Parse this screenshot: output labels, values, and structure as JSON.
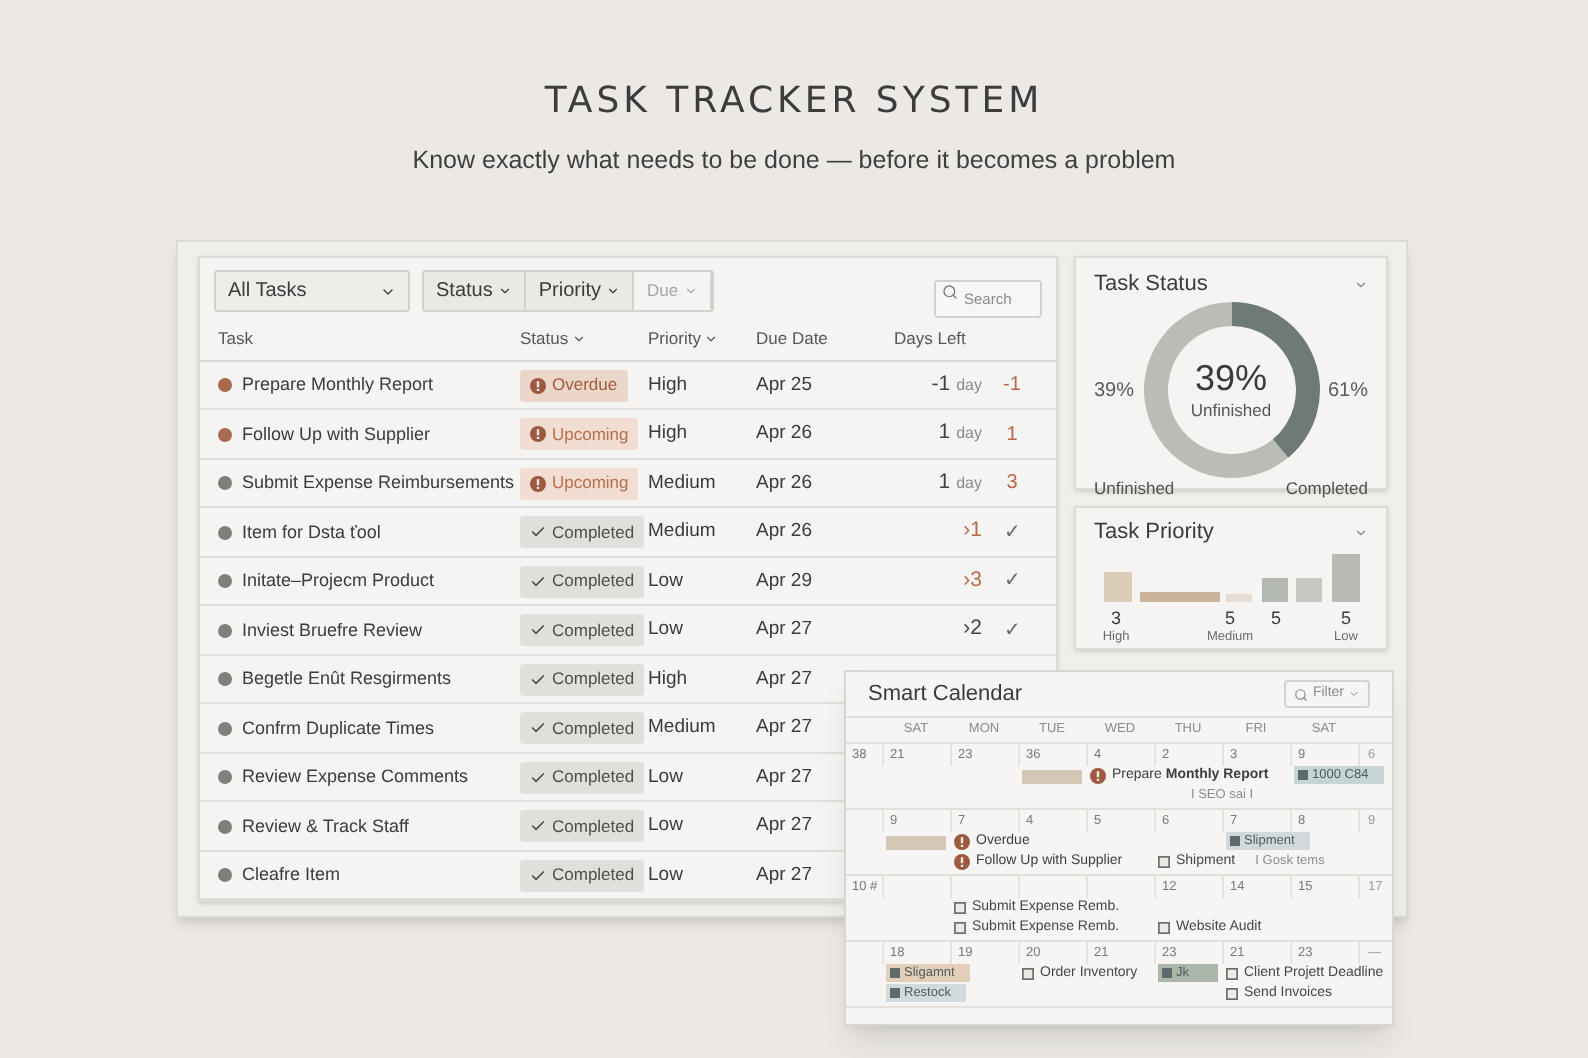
{
  "page": {
    "title": "TASK TRACKER SYSTEM",
    "subtitle": "Know exactly what needs to be done — before it becomes a problem"
  },
  "toolbar": {
    "view": {
      "label": "All Tasks"
    },
    "filters": [
      {
        "label": "Status",
        "disabled": false
      },
      {
        "label": "Priority",
        "disabled": false
      },
      {
        "label": "Due",
        "disabled": true
      }
    ],
    "search": {
      "placeholder": "Search"
    }
  },
  "table": {
    "columns": [
      {
        "label": "Task",
        "sortable": false
      },
      {
        "label": "Status",
        "sortable": true
      },
      {
        "label": "Priority",
        "sortable": true
      },
      {
        "label": "Due Date",
        "sortable": false
      },
      {
        "label": "Days Left",
        "sortable": false
      }
    ],
    "rows": [
      {
        "task": "Prepare Monthly Report",
        "color": "#a86a4f",
        "status": {
          "kind": "overdue",
          "label": "Overdue"
        },
        "priority": "High",
        "due": "Apr 25",
        "days_left": {
          "text": "-1",
          "unit": "day",
          "color": "#3f423f"
        },
        "extra": {
          "text": "-1",
          "color": "#b5694a"
        }
      },
      {
        "task": "Follow Up with Supplier",
        "color": "#a86a4f",
        "status": {
          "kind": "upcoming",
          "label": "Upcoming"
        },
        "priority": "High",
        "due": "Apr 26",
        "days_left": {
          "text": "1",
          "unit": "day",
          "color": "#3f423f"
        },
        "extra": {
          "text": "1",
          "color": "#b5694a"
        }
      },
      {
        "task": "Submit Expense Reimbursements",
        "color": "#7d807b",
        "status": {
          "kind": "upcoming",
          "label": "Upcoming"
        },
        "priority": "Medium",
        "due": "Apr 26",
        "days_left": {
          "text": "1",
          "unit": "day",
          "color": "#3f423f"
        },
        "extra": {
          "text": "3",
          "color": "#b5694a"
        }
      },
      {
        "task": "Item for Dsta ťool",
        "color": "#7d807b",
        "status": {
          "kind": "completed",
          "label": "Completed"
        },
        "priority": "Medium",
        "due": "Apr 26",
        "days_left": {
          "text": "›1",
          "color": "#b5694a"
        },
        "extra": {
          "text": "✓",
          "color": "#6a6d69"
        }
      },
      {
        "task": "Initate–Projecm Product",
        "color": "#7d807b",
        "status": {
          "kind": "completed",
          "label": "Completed"
        },
        "priority": "Low",
        "due": "Apr 29",
        "days_left": {
          "text": "›3",
          "color": "#b5694a"
        },
        "extra": {
          "text": "✓",
          "color": "#6a6d69"
        }
      },
      {
        "task": "Inviest Bruefre Review",
        "color": "#7d807b",
        "status": {
          "kind": "completed",
          "label": "Completed"
        },
        "priority": "Low",
        "due": "Apr 27",
        "days_left": {
          "text": "›2",
          "color": "#3f423f"
        },
        "extra": {
          "text": "✓",
          "color": "#6a6d69"
        }
      },
      {
        "task": "Begetle Enût Resgirments",
        "color": "#7d807b",
        "status": {
          "kind": "completed",
          "label": "Completed"
        },
        "priority": "High",
        "due": "Apr 27"
      },
      {
        "task": "Confrm Duplicate Times",
        "color": "#7d807b",
        "status": {
          "kind": "completed",
          "label": "Completed"
        },
        "priority": "Medium",
        "due": "Apr 27"
      },
      {
        "task": "Review Expense Comments",
        "color": "#7d807b",
        "status": {
          "kind": "completed",
          "label": "Completed"
        },
        "priority": "Low",
        "due": "Apr 27"
      },
      {
        "task": "Review & Track Staff",
        "color": "#7d807b",
        "status": {
          "kind": "completed",
          "label": "Completed"
        },
        "priority": "Low",
        "due": "Apr 27"
      },
      {
        "task": "Cleafre Item",
        "color": "#7d807b",
        "status": {
          "kind": "completed",
          "label": "Completed"
        },
        "priority": "Low",
        "due": "Apr 27"
      }
    ]
  },
  "task_status": {
    "title": "Task Status",
    "center_value": "39%",
    "center_label": "Unfinished",
    "left_value": "39%",
    "right_value": "61%",
    "chart_data": {
      "type": "donut",
      "categories": [
        "Unfinished",
        "Completed"
      ],
      "values": [
        39,
        61
      ]
    }
  },
  "task_priority": {
    "title": "Task Priority",
    "values": [
      "3",
      "5",
      "5",
      "5"
    ],
    "labels": [
      "High",
      "Medium",
      "Low"
    ]
  },
  "calendar": {
    "title": "Smart Calendar",
    "filter": {
      "label": "Filter"
    },
    "weekdays": [
      "SAT",
      "MON",
      "TUE",
      "WED",
      "THU",
      "FRI",
      "SAT"
    ],
    "weeks": [
      {
        "week": "38",
        "days": [
          "21",
          "23",
          "36",
          "4",
          "2",
          "3",
          "9"
        ],
        "extra": "6",
        "lines": [
          [
            {
              "kind": "bar",
              "color": "#d3c7b6"
            },
            {
              "kind": "overdue",
              "text": "Prepare **Monthly Report**"
            },
            {
              "kind": "tag",
              "text": "1000 C84",
              "color": "#c7d4d6"
            }
          ],
          [
            {
              "kind": "note",
              "text": "I SEO sai I"
            }
          ]
        ]
      },
      {
        "days": [
          "9",
          "7",
          "4",
          "5",
          "6",
          "7",
          "8"
        ],
        "extra": "9",
        "lines": [
          [
            {
              "kind": "bar",
              "color": "#d3c7b6"
            },
            {
              "kind": "overdue",
              "text": "Overdue"
            },
            {
              "kind": "tag",
              "text": "Slipment",
              "color": "#d2d9dc"
            }
          ],
          [
            {
              "kind": "overdue",
              "text": "Follow Up with Supplier"
            },
            {
              "kind": "item",
              "text": "Shipment"
            },
            {
              "kind": "note",
              "text": "I Gosk tems"
            }
          ]
        ]
      },
      {
        "week": "10 #",
        "days": [
          "12",
          "14",
          "15"
        ],
        "extra": "17",
        "lines": [
          [
            {
              "kind": "item",
              "text": "Submit Expense Remb."
            }
          ],
          [
            {
              "kind": "item",
              "text": "Submit Expense Remb."
            },
            {
              "kind": "item",
              "text": "Website Audit"
            }
          ]
        ]
      },
      {
        "days": [
          "18",
          "19",
          "20",
          "21",
          "23",
          "21",
          "23"
        ],
        "extra": "—",
        "lines": [
          [
            {
              "kind": "tag",
              "text": "Sligamnt",
              "color": "#e3cfb9"
            },
            {
              "kind": "item",
              "text": "Order Inventory"
            },
            {
              "kind": "tag",
              "text": "Jk",
              "color": "#aab6a9"
            },
            {
              "kind": "item",
              "text": "Client Projett Deadline"
            }
          ],
          [
            {
              "kind": "tag",
              "text": "Restock",
              "color": "#d3dade"
            },
            {
              "kind": "item",
              "text": "Send Invoices"
            }
          ]
        ]
      }
    ]
  }
}
